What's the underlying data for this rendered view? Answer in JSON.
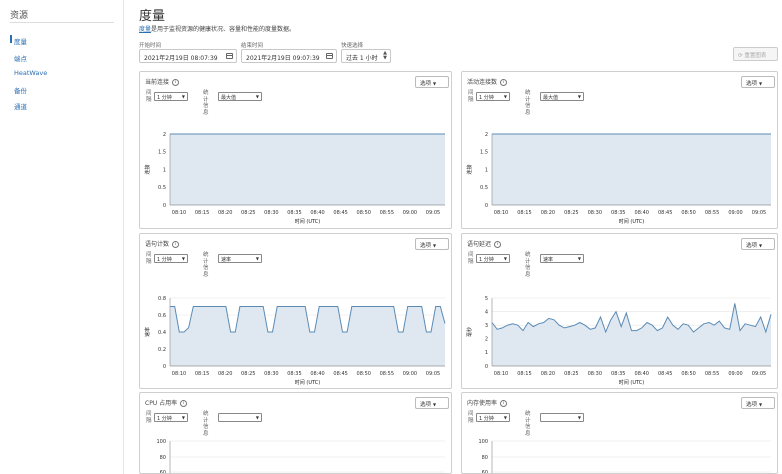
{
  "sidebar": {
    "title": "资源",
    "items": [
      {
        "label": "度量",
        "active": true
      },
      {
        "label": "端点"
      },
      {
        "label": "HeatWave"
      },
      {
        "label": "备份"
      },
      {
        "label": "通道"
      }
    ]
  },
  "header": {
    "title": "度量",
    "desc_link": "度量",
    "desc_rest": "是用于监视资源的健康状况、容量和性能的度量数据。"
  },
  "filters": {
    "start_label": "开始时间",
    "start_value": "2021年2月19日 08:07:39",
    "end_label": "结束时间",
    "end_value": "2021年2月19日 09:07:39",
    "quick_label": "快速选择",
    "quick_value": "过去 1 小时",
    "refresh_label": "重置图表"
  },
  "colors": {
    "line": "#5b8bb5",
    "fill": "#dfe8f1",
    "link": "#2a6fb3"
  },
  "common": {
    "options_label": "选项",
    "interval_label": "间隔",
    "stat_label": "统计信息",
    "interval_value": "1 分钟",
    "x_title": "时间 (UTC)",
    "x_ticks": [
      "08:10",
      "08:15",
      "08:20",
      "08:25",
      "08:30",
      "08:35",
      "08:40",
      "08:45",
      "08:50",
      "08:55",
      "09:00",
      "09:05"
    ]
  },
  "panels": [
    {
      "title": "当前连接",
      "stat": "最大值",
      "y_title": "连接"
    },
    {
      "title": "活动连接数",
      "stat": "最大值",
      "y_title": "连接"
    },
    {
      "title": "语句计数",
      "stat": "速率",
      "y_title": "速率"
    },
    {
      "title": "语句延迟",
      "stat": "速率",
      "y_title": "毫秒"
    },
    {
      "title": "CPU 占用率",
      "stat": "",
      "y_title": ""
    },
    {
      "title": "内存使用率",
      "stat": "",
      "y_title": ""
    }
  ],
  "chart_data": [
    {
      "type": "area",
      "title": "当前连接",
      "xlabel": "时间 (UTC)",
      "ylabel": "连接",
      "ylim": [
        0,
        2
      ],
      "y_ticks": [
        0,
        0.5,
        1,
        1.5,
        2
      ],
      "x": [
        "08:08",
        "08:10",
        "08:15",
        "08:20",
        "08:25",
        "08:30",
        "08:35",
        "08:40",
        "08:45",
        "08:50",
        "08:55",
        "09:00",
        "09:05",
        "09:07"
      ],
      "values": [
        2,
        2,
        2,
        2,
        2,
        2,
        2,
        2,
        2,
        2,
        2,
        2,
        2,
        2
      ]
    },
    {
      "type": "area",
      "title": "活动连接数",
      "xlabel": "时间 (UTC)",
      "ylabel": "连接",
      "ylim": [
        0,
        2
      ],
      "y_ticks": [
        0,
        0.5,
        1,
        1.5,
        2
      ],
      "x": [
        "08:08",
        "08:10",
        "08:15",
        "08:20",
        "08:25",
        "08:30",
        "08:35",
        "08:40",
        "08:45",
        "08:50",
        "08:55",
        "09:00",
        "09:05",
        "09:07"
      ],
      "values": [
        2,
        2,
        2,
        2,
        2,
        2,
        2,
        2,
        2,
        2,
        2,
        2,
        2,
        2
      ]
    },
    {
      "type": "area",
      "title": "语句计数",
      "xlabel": "时间 (UTC)",
      "ylabel": "速率",
      "ylim": [
        0,
        0.8
      ],
      "y_ticks": [
        0,
        0.2,
        0.4,
        0.6,
        0.8
      ],
      "values": [
        0.7,
        0.7,
        0.4,
        0.4,
        0.45,
        0.7,
        0.7,
        0.7,
        0.7,
        0.7,
        0.7,
        0.7,
        0.7,
        0.4,
        0.4,
        0.7,
        0.7,
        0.7,
        0.7,
        0.7,
        0.7,
        0.4,
        0.4,
        0.7,
        0.7,
        0.7,
        0.7,
        0.7,
        0.7,
        0.7,
        0.4,
        0.4,
        0.7,
        0.7,
        0.7,
        0.7,
        0.7,
        0.4,
        0.4,
        0.7,
        0.7,
        0.7,
        0.7,
        0.7,
        0.7,
        0.7,
        0.7,
        0.7,
        0.7,
        0.4,
        0.4,
        0.7,
        0.7,
        0.7,
        0.7,
        0.4,
        0.4,
        0.7,
        0.7,
        0.5
      ]
    },
    {
      "type": "area",
      "title": "语句延迟",
      "xlabel": "时间 (UTC)",
      "ylabel": "毫秒",
      "ylim": [
        0,
        5
      ],
      "y_ticks": [
        0,
        1,
        2,
        3,
        4,
        5
      ],
      "values": [
        3.2,
        2.7,
        2.8,
        3.0,
        3.1,
        3.0,
        2.6,
        3.2,
        2.9,
        3.1,
        3.2,
        3.5,
        3.4,
        3.0,
        2.8,
        2.9,
        3.0,
        3.2,
        3.0,
        2.7,
        2.8,
        3.6,
        2.5,
        3.4,
        4.0,
        2.9,
        3.9,
        2.6,
        2.6,
        2.8,
        3.2,
        3.0,
        2.6,
        2.8,
        3.6,
        3.0,
        2.7,
        3.1,
        3.0,
        2.5,
        2.8,
        3.1,
        3.2,
        3.0,
        3.3,
        2.8,
        2.7,
        4.6,
        2.6,
        3.1,
        3.0,
        2.9,
        3.6,
        2.5,
        3.8
      ]
    }
  ]
}
